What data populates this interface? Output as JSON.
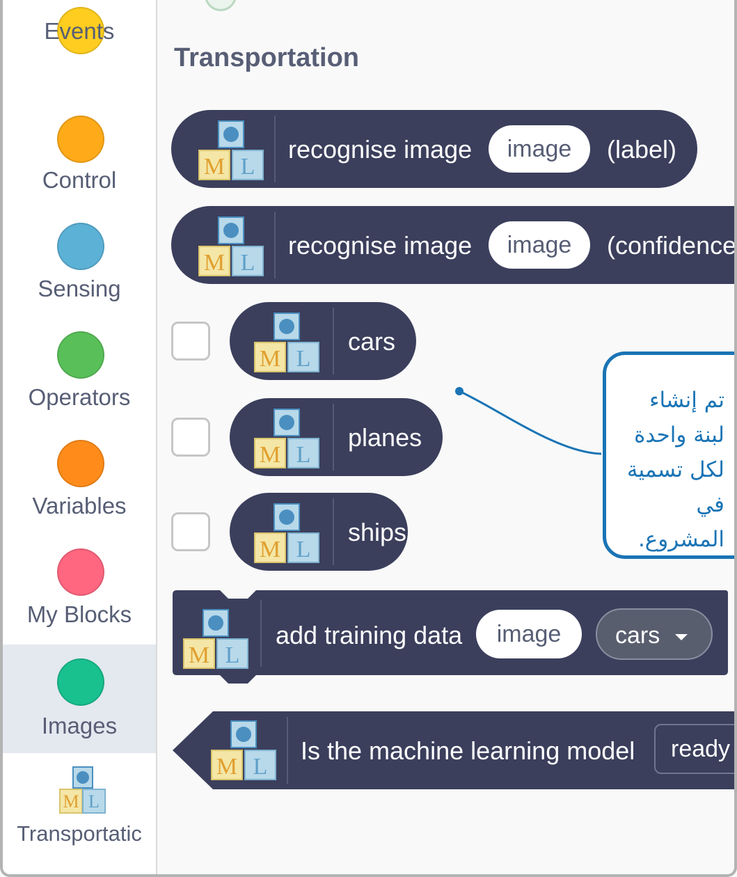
{
  "sidebar": {
    "categories": [
      {
        "label": "Events",
        "color": "#ffcd1f"
      },
      {
        "label": "Control",
        "color": "#ffab19"
      },
      {
        "label": "Sensing",
        "color": "#5cb1d6"
      },
      {
        "label": "Operators",
        "color": "#59c059"
      },
      {
        "label": "Variables",
        "color": "#ff8c1a"
      },
      {
        "label": "My Blocks",
        "color": "#ff6680"
      },
      {
        "label": "Images",
        "color": "#19c18e"
      }
    ],
    "selected_category": "Images",
    "extension_label": "Transportatic",
    "extension_icon": "ml-blocks-icon"
  },
  "workspace": {
    "title": "Transportation",
    "blocks": {
      "recognise_label": {
        "text": "recognise image",
        "input": "image",
        "suffix": "(label)"
      },
      "recognise_confidence": {
        "text": "recognise image",
        "input": "image",
        "suffix": "(confidence"
      },
      "labels": [
        "cars",
        "planes",
        "ships"
      ],
      "add_training": {
        "text": "add training data",
        "input": "image",
        "dropdown": "cars"
      },
      "model_ready": {
        "text": "Is the machine learning model",
        "dropdown": "ready"
      }
    }
  },
  "callout": {
    "text_lines": [
      "تم إنشاء",
      "لبنة واحدة",
      "لكل تسمية في",
      "المشروع."
    ],
    "border_color": "#1a74b5"
  },
  "colors": {
    "block": "#3b3f5c",
    "ml_yellow": "#f4e6a6",
    "ml_blue": "#b8d9ea"
  }
}
